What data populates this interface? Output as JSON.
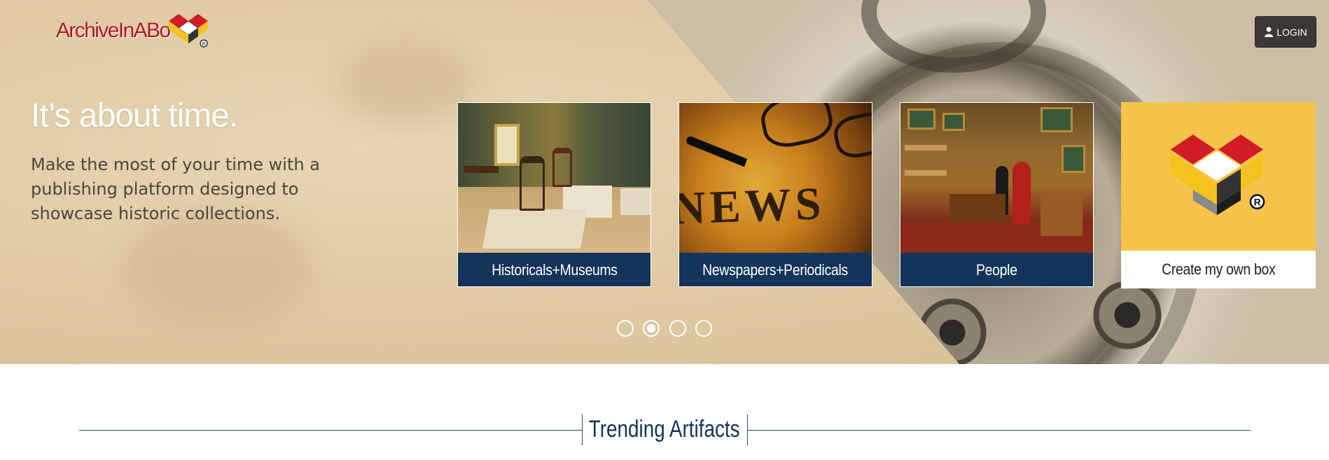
{
  "brand": {
    "name": "ArchiveInABox",
    "logo_text": "ArchiveInABo",
    "registered_mark": "®"
  },
  "header": {
    "login_label": "LOGIN",
    "login_icon": "user-icon"
  },
  "hero": {
    "headline": "It’s about time.",
    "subcopy": "Make the most of your time with a publishing platform designed to showcase historic collections."
  },
  "categories": [
    {
      "label": "Historicals+Museums",
      "image": "museum-interior"
    },
    {
      "label": "Newspapers+Periodicals",
      "image": "newspaper-glasses-pen"
    },
    {
      "label": "People",
      "image": "antique-shop-people"
    },
    {
      "label": "Create my own box",
      "image": "archiveinabox-logo-mark"
    }
  ],
  "carousel": {
    "slide_count": 4,
    "active_index": 1
  },
  "trending": {
    "title": "Trending Artifacts"
  },
  "colors": {
    "brand_red": "#b3121b",
    "navy": "#14345a",
    "logo_yellow": "#f8c34a",
    "login_bg": "#3b3733"
  }
}
